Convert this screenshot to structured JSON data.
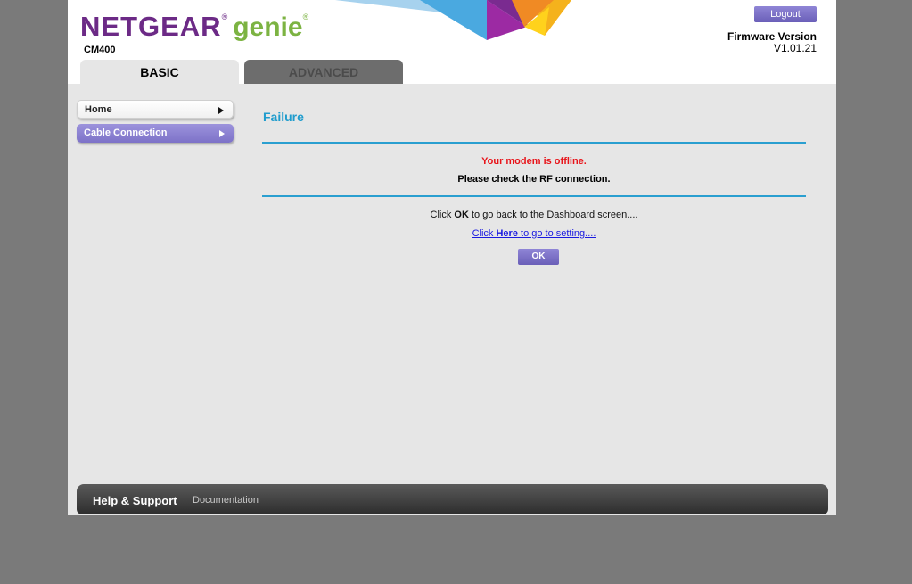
{
  "header": {
    "brand_netgear": "NETGEAR",
    "brand_reg": "®",
    "brand_genie": "genie",
    "model": "CM400",
    "logout_label": "Logout",
    "firmware_label": "Firmware Version",
    "firmware_value": "V1.01.21"
  },
  "tabs": [
    {
      "label": "BASIC",
      "active": true
    },
    {
      "label": "ADVANCED",
      "active": false
    }
  ],
  "sidebar": {
    "items": [
      {
        "label": "Home",
        "active": false
      },
      {
        "label": "Cable Connection",
        "active": true
      }
    ]
  },
  "main": {
    "title": "Failure",
    "offline_msg": "Your modem is offline.",
    "check_msg": "Please check the RF connection.",
    "click_pre": "Click ",
    "click_ok": "OK",
    "click_post": " to go back to the Dashboard screen....",
    "link_pre": "Click ",
    "link_here": "Here",
    "link_post": " to go to setting....",
    "ok_label": "OK"
  },
  "footer": {
    "help_label": "Help & Support",
    "docs_label": "Documentation"
  },
  "colors": {
    "brand_purple": "#6c2a86",
    "brand_green": "#7cb342",
    "accent_blue": "#1f9ccd",
    "error_red": "#e8141a",
    "button_purple": "#7d72c8"
  }
}
